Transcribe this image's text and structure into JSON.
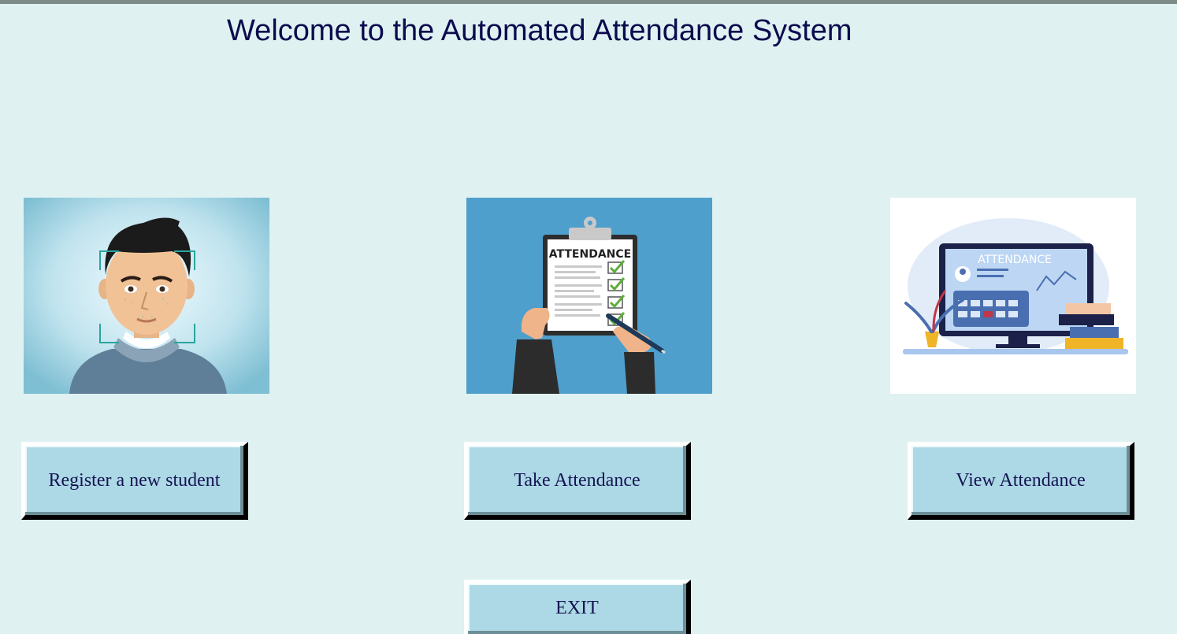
{
  "window": {
    "title": "Welcome to the Automated Attendance System"
  },
  "cards": [
    {
      "image_icon": "face-recognition-illustration",
      "button_label": "Register a new student"
    },
    {
      "image_icon": "attendance-clipboard-illustration",
      "image_text": "ATTENDANCE",
      "button_label": "Take Attendance"
    },
    {
      "image_icon": "attendance-monitor-illustration",
      "image_text": "ATTENDANCE",
      "button_label": "View Attendance"
    }
  ],
  "exit": {
    "label": "EXIT"
  },
  "colors": {
    "background": "#dff1f1",
    "button_face": "#add8e6",
    "title_text": "#0b0b4e",
    "button_text": "#141452"
  }
}
